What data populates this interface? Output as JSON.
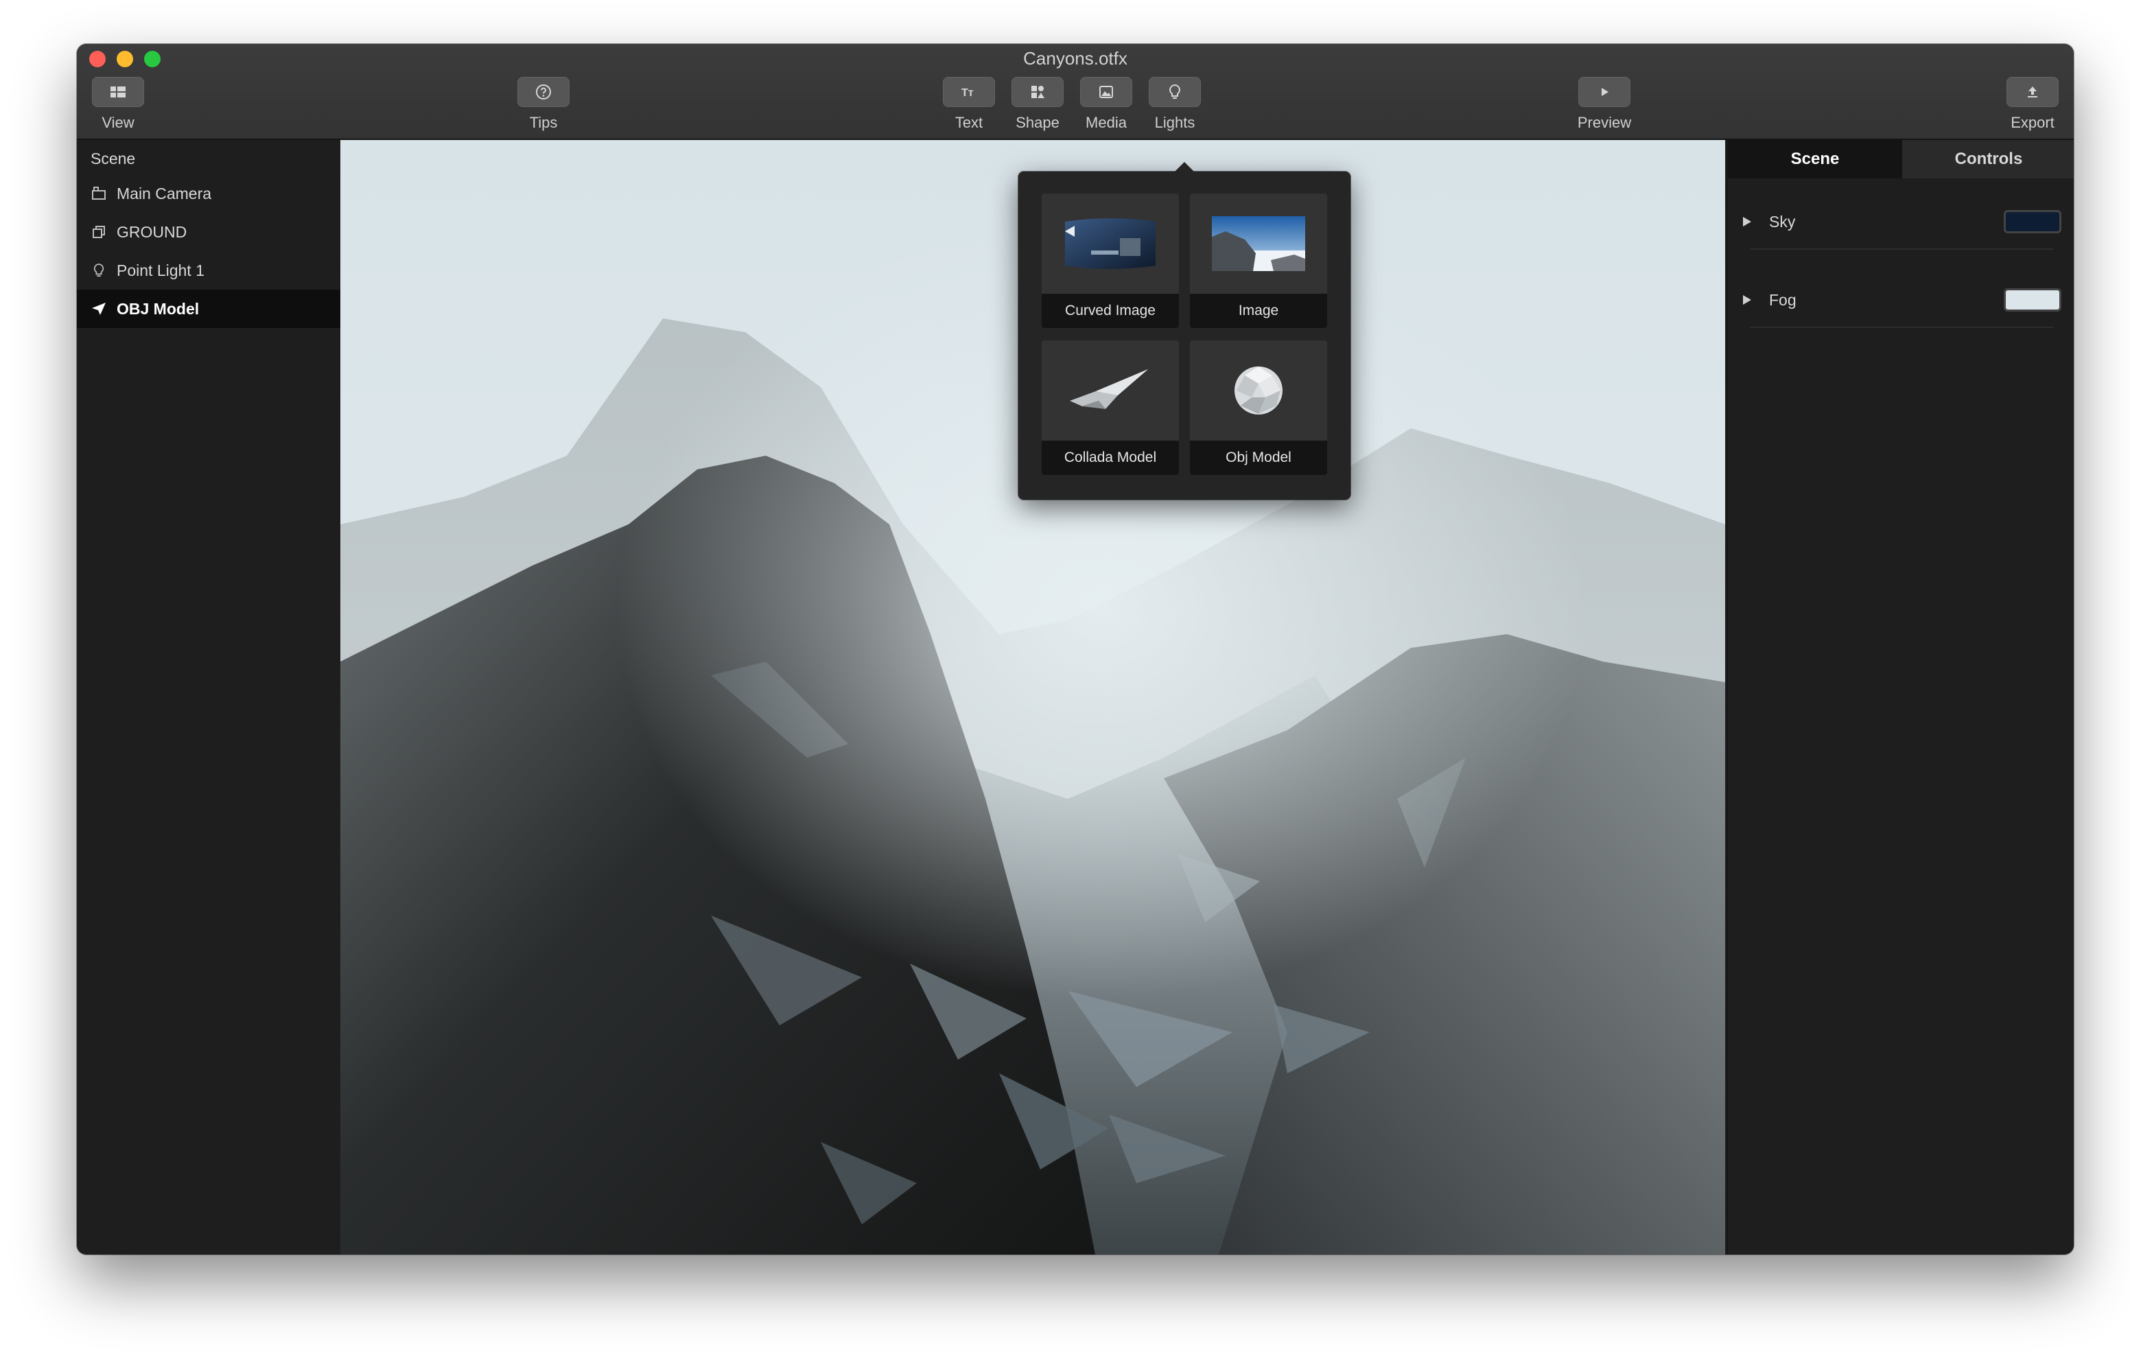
{
  "window": {
    "title": "Canyons.otfx"
  },
  "toolbar": {
    "view": "View",
    "tips": "Tips",
    "text": "Text",
    "shape": "Shape",
    "media": "Media",
    "lights": "Lights",
    "preview": "Preview",
    "export": "Export"
  },
  "sidebar": {
    "header": "Scene",
    "items": [
      {
        "label": "Main Camera",
        "icon": "camera-icon"
      },
      {
        "label": "GROUND",
        "icon": "cube-icon"
      },
      {
        "label": "Point Light 1",
        "icon": "lightbulb-icon"
      },
      {
        "label": "OBJ Model",
        "icon": "model-icon",
        "selected": true
      }
    ]
  },
  "media_popover": {
    "items": [
      {
        "label": "Curved Image"
      },
      {
        "label": "Image"
      },
      {
        "label": "Collada Model"
      },
      {
        "label": "Obj Model"
      }
    ]
  },
  "inspector": {
    "tabs": [
      {
        "label": "Scene",
        "active": true
      },
      {
        "label": "Controls"
      }
    ],
    "properties": [
      {
        "label": "Sky",
        "color": "#0d1d33"
      },
      {
        "label": "Fog",
        "color": "#dce6ea"
      }
    ]
  },
  "colors": {
    "traffic_red": "#fe5f57",
    "traffic_yellow": "#febc2e",
    "traffic_green": "#28c840",
    "sky_color": "#0d1d33",
    "fog_color": "#dce6ea"
  }
}
